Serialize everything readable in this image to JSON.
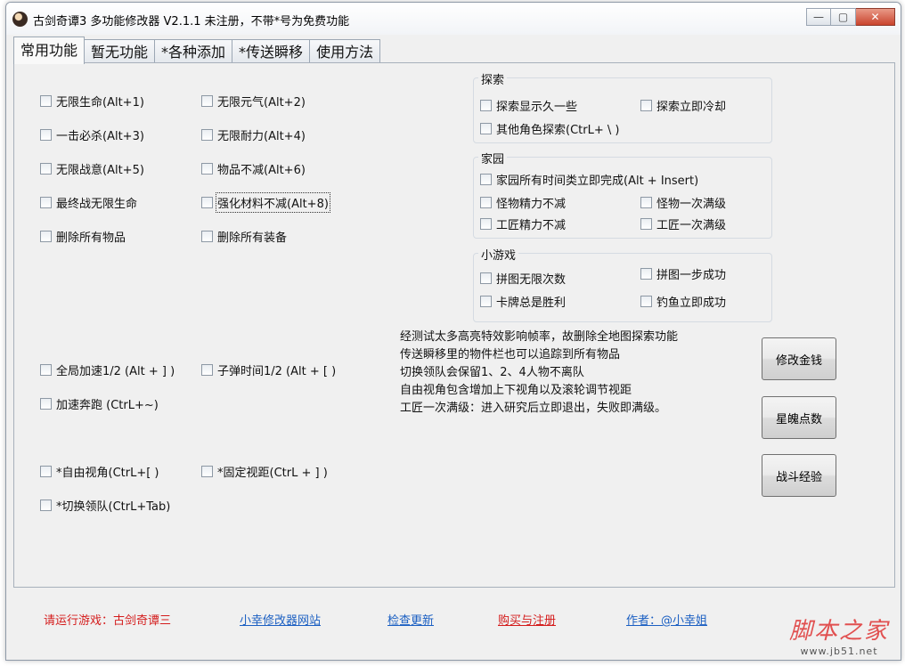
{
  "window": {
    "title": "古剑奇谭3 多功能修改器  V2.1.1 未注册，不带*号为免费功能",
    "min_glyph": "—",
    "max_glyph": "▢",
    "close_glyph": "✕"
  },
  "tabs": [
    "常用功能",
    "暂无功能",
    "*各种添加",
    "*传送瞬移",
    "使用方法"
  ],
  "left_options": {
    "row1": [
      "无限生命(Alt+1)",
      "无限元气(Alt+2)"
    ],
    "row2": [
      "一击必杀(Alt+3)",
      "无限耐力(Alt+4)"
    ],
    "row3": [
      "无限战意(Alt+5)",
      "物品不减(Alt+6)"
    ],
    "row4": [
      "最终战无限生命",
      "强化材料不减(Alt+8)"
    ],
    "row5": [
      "删除所有物品",
      "删除所有装备"
    ],
    "row6": [
      "全局加速1/2 (Alt + ] )",
      "子弹时间1/2 (Alt + [ )"
    ],
    "row7": [
      "加速奔跑 (CtrL+~)"
    ],
    "row8": [
      "*自由视角(CtrL+[ )",
      "*固定视距(CtrL + ] )"
    ],
    "row9": [
      "*切换领队(CtrL+Tab)"
    ]
  },
  "groups": {
    "explore": {
      "legend": "探索",
      "options": [
        "探索显示久一些",
        "探索立即冷却",
        "其他角色探索(CtrL+ \\ )"
      ]
    },
    "home": {
      "legend": "家园",
      "options": [
        "家园所有时间类立即完成(Alt + Insert)",
        "怪物精力不减",
        "怪物一次满级",
        "工匠精力不减",
        "工匠一次满级"
      ]
    },
    "minigame": {
      "legend": "小游戏",
      "options": [
        "拼图无限次数",
        "拼图一步成功",
        "卡牌总是胜利",
        "钓鱼立即成功"
      ]
    }
  },
  "notes": [
    "经测试太多高亮特效影响帧率，故删除全地图探索功能",
    "传送瞬移里的物件栏也可以追踪到所有物品",
    "切换领队会保留1、2、4人物不离队",
    "自由视角包含增加上下视角以及滚轮调节视距",
    "工匠一次满级：进入研究后立即退出，失败即满级。"
  ],
  "buttons": [
    "修改金钱",
    "星魄点数",
    "战斗经验"
  ],
  "status": {
    "run_game": "请运行游戏：古剑奇谭三",
    "website": "小幸修改器网站",
    "update": "检查更新",
    "register": "购买与注册",
    "author": "作者：@小幸姐"
  },
  "watermark": {
    "main": "脚本之家",
    "sub": "www.jb51.net"
  },
  "colors": {
    "link": "#1b5fc2",
    "status_red": "#d41c1c",
    "watermark": "#e15050"
  }
}
